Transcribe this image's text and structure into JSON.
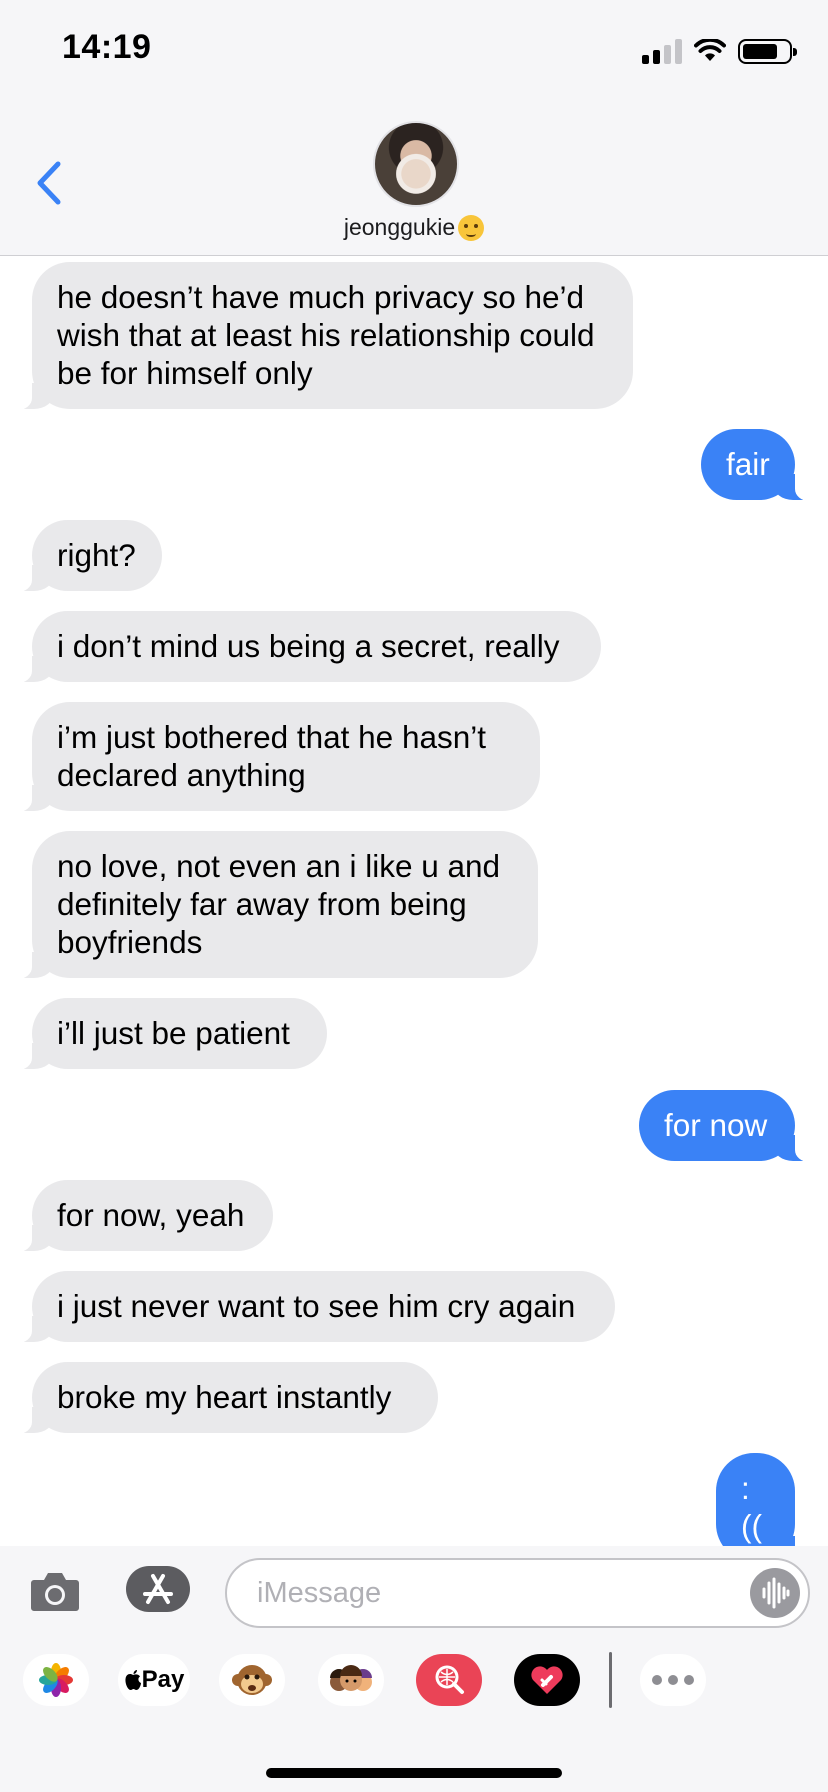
{
  "status_bar": {
    "time": "14:19"
  },
  "header": {
    "contact_name": "jeonggukie"
  },
  "messages": [
    {
      "direction": "in",
      "text": "he doesn’t have much privacy so he’d wish that at least his relationship could be for himself only"
    },
    {
      "direction": "out",
      "text": "fair"
    },
    {
      "direction": "in",
      "text": "right?"
    },
    {
      "direction": "in",
      "text": "i don’t mind us being a secret, really"
    },
    {
      "direction": "in",
      "text": "i’m just bothered that he hasn’t declared anything"
    },
    {
      "direction": "in",
      "text": "no love, not even an i like u and definitely far away from being boyfriends"
    },
    {
      "direction": "in",
      "text": "i’ll just be patient"
    },
    {
      "direction": "out",
      "text": "for now"
    },
    {
      "direction": "in",
      "text": "for now, yeah"
    },
    {
      "direction": "in",
      "text": "i just never want to see him cry again"
    },
    {
      "direction": "in",
      "text": "broke my heart instantly"
    },
    {
      "direction": "out",
      "text": ":(("
    }
  ],
  "composer": {
    "placeholder": "iMessage",
    "value": ""
  },
  "app_tray": {
    "apps": [
      "photos-icon",
      "apple-pay-icon",
      "animoji-icon",
      "memoji-icon",
      "image-search-icon",
      "digital-touch-icon",
      "more-icon"
    ],
    "pay_label": "Pay"
  },
  "colors": {
    "outgoing_bubble": "#3a82f6",
    "incoming_bubble": "#e9e9eb",
    "accent": "#3a82f6"
  }
}
